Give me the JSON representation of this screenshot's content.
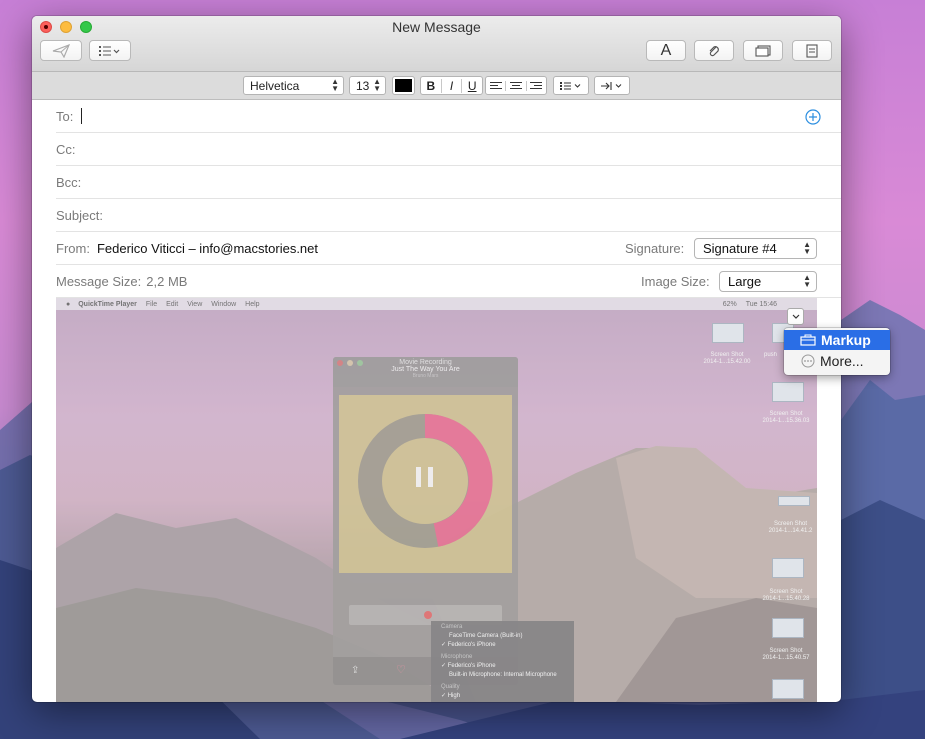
{
  "window": {
    "title": "New Message"
  },
  "toolbar": {
    "send_label": "",
    "font_button_label": "A"
  },
  "format": {
    "font_name": "Helvetica",
    "font_size": "13",
    "color": "#000000",
    "bold": "B",
    "italic": "I",
    "underline": "U"
  },
  "fields": {
    "to_label": "To:",
    "cc_label": "Cc:",
    "bcc_label": "Bcc:",
    "subject_label": "Subject:",
    "from_label": "From:",
    "from_value": "Federico Viticci – info@macstories.net",
    "signature_label": "Signature:",
    "signature_value": "Signature #4",
    "message_size_label": "Message Size:",
    "message_size_value": "2,2 MB",
    "image_size_label": "Image Size:",
    "image_size_value": "Large"
  },
  "screenshot": {
    "menubar": [
      "QuickTime Player",
      "File",
      "Edit",
      "View",
      "Window",
      "Help"
    ],
    "battery": "62%",
    "clock": "Tue 15:46",
    "qt_title": "Movie Recording",
    "qt_song": "Just The Way You Are",
    "qt_artist": "Bruno Mars",
    "camera_header": "Camera",
    "camera_options": [
      "FaceTime Camera (Built-in)",
      "✓ Federico's iPhone"
    ],
    "mic_header": "Microphone",
    "mic_options": [
      "✓ Federico's iPhone",
      "Built-in Microphone: Internal Microphone"
    ],
    "quality_header": "Quality",
    "quality_option": "✓ High",
    "desktop_icons": [
      {
        "name": "Screen Shot",
        "date": "2014-1...15.42.00"
      },
      {
        "name": "Screen Shot",
        "date": "2014-1...15.36.03"
      },
      {
        "name": "Screen Shot",
        "date": "2014-1...14.41.2"
      },
      {
        "name": "Screen Shot",
        "date": "2014-1...15.40.28"
      },
      {
        "name": "Screen Shot",
        "date": "2014-1...15.40.57"
      }
    ],
    "partial_icon_label": "push"
  },
  "markup_menu": {
    "markup_label": "Markup",
    "more_label": "More..."
  },
  "colors": {
    "accent": "#2a6ee6",
    "close": "#fc605c",
    "minimize": "#fdbc40",
    "maximize": "#34c84a",
    "add_contact": "#2b8ee0"
  }
}
